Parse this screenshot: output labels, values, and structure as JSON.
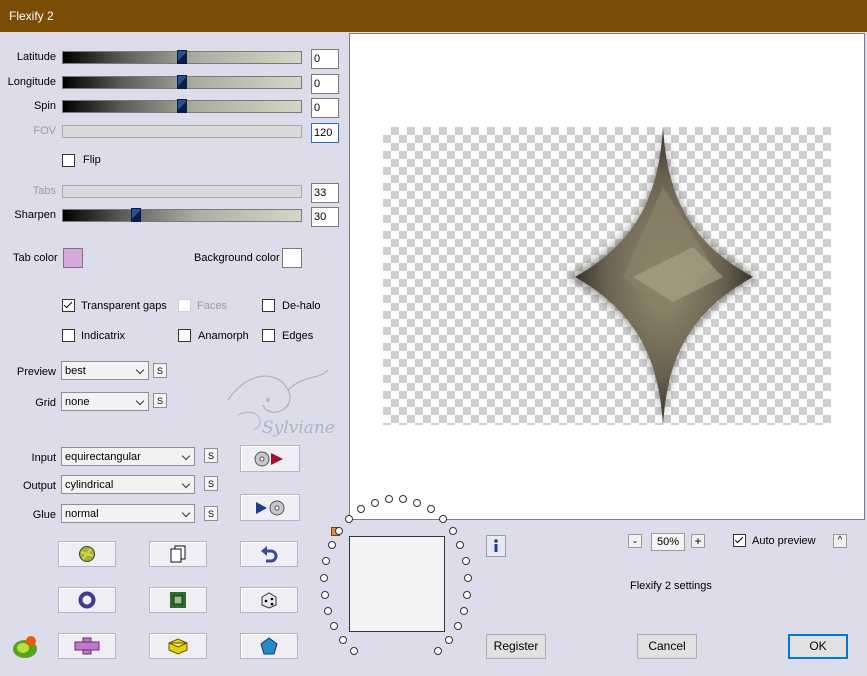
{
  "window": {
    "title": "Flexify 2"
  },
  "sliders": [
    {
      "label": "Latitude",
      "value": "0",
      "level": 0.5,
      "enabled": true
    },
    {
      "label": "Longitude",
      "value": "0",
      "level": 0.5,
      "enabled": true
    },
    {
      "label": "Spin",
      "value": "0",
      "level": 0.5,
      "enabled": true
    },
    {
      "label": "FOV",
      "value": "120",
      "enabled": false
    },
    {
      "label": "Tabs",
      "value": "33",
      "enabled": false
    },
    {
      "label": "Sharpen",
      "value": "30",
      "level": 0.3,
      "enabled": true
    }
  ],
  "flip": {
    "label": "Flip",
    "checked": false
  },
  "tab_color": {
    "label": "Tab color",
    "color": "#d8a8dc"
  },
  "background_color": {
    "label": "Background color",
    "color": "#ffffff"
  },
  "options": {
    "transparent_gaps": {
      "label": "Transparent gaps",
      "checked": true
    },
    "faces": {
      "label": "Faces",
      "checked": false,
      "enabled": false
    },
    "de_halo": {
      "label": "De-halo",
      "checked": false
    },
    "indicatrix": {
      "label": "Indicatrix",
      "checked": false
    },
    "anamorph": {
      "label": "Anamorph",
      "checked": false
    },
    "edges": {
      "label": "Edges",
      "checked": false
    }
  },
  "preview_select": {
    "label": "Preview",
    "value": "best"
  },
  "grid_select": {
    "label": "Grid",
    "value": "none"
  },
  "input_select": {
    "label": "Input",
    "value": "equirectangular"
  },
  "output_select": {
    "label": "Output",
    "value": "cylindrical"
  },
  "glue_select": {
    "label": "Glue",
    "value": "normal"
  },
  "small_button_label": "S",
  "watermark": "Sylviane",
  "zoom": {
    "value": "50%",
    "minus": "-",
    "plus": "+"
  },
  "auto_preview": {
    "label": "Auto preview",
    "checked": true
  },
  "up_button": "^",
  "settings_name": "Flexify 2 settings",
  "buttons": {
    "register": "Register",
    "cancel": "Cancel",
    "ok": "OK"
  },
  "icons": [
    "play-to-disc-icon",
    "disc-to-play-icon",
    "globe-icon",
    "copy-icon",
    "undo-icon",
    "donut-icon",
    "chip-icon",
    "dice-icon",
    "flower-icon",
    "cross-icon",
    "cube-icon",
    "gem-icon",
    "info-icon",
    "logo-icon"
  ]
}
